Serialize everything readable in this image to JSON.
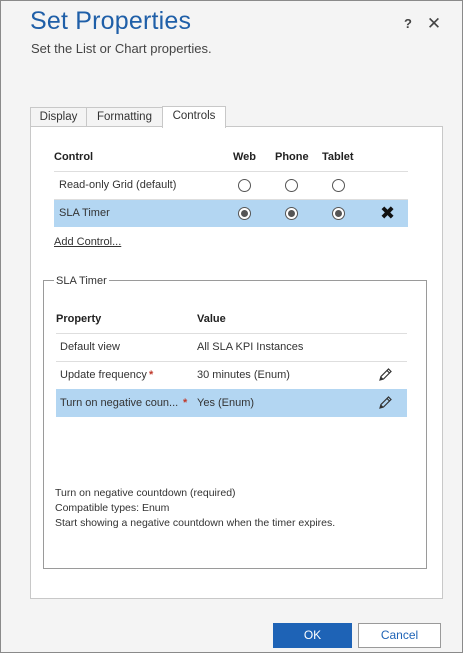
{
  "dialog": {
    "title": "Set Properties",
    "subtitle": "Set the List or Chart properties.",
    "help_label": "?",
    "close_label": "✕"
  },
  "tabs": [
    {
      "label": "Display",
      "active": false
    },
    {
      "label": "Formatting",
      "active": false
    },
    {
      "label": "Controls",
      "active": true
    }
  ],
  "controls_grid": {
    "headers": {
      "control": "Control",
      "web": "Web",
      "phone": "Phone",
      "tablet": "Tablet"
    },
    "rows": [
      {
        "name": "Read-only Grid (default)",
        "web": false,
        "phone": false,
        "tablet": false,
        "selected": false
      },
      {
        "name": "SLA Timer",
        "web": true,
        "phone": true,
        "tablet": true,
        "selected": true,
        "remove_icon": "✖"
      }
    ]
  },
  "add_control_label": "Add Control...",
  "sla_timer": {
    "legend": "SLA Timer",
    "headers": {
      "property": "Property",
      "value": "Value"
    },
    "rows": [
      {
        "property": "Default view",
        "value": "All SLA KPI Instances",
        "required": false,
        "editable": false,
        "selected": false
      },
      {
        "property": "Update frequency",
        "value": "30 minutes (Enum)",
        "required": true,
        "editable": true,
        "selected": false
      },
      {
        "property": "Turn on negative coun...",
        "value": "Yes (Enum)",
        "required": true,
        "editable": true,
        "selected": true
      }
    ],
    "required_mark": "*",
    "info": [
      "Turn on negative countdown (required)",
      "Compatible types: Enum",
      "Start showing a negative countdown when the timer expires."
    ]
  },
  "buttons": {
    "ok": "OK",
    "cancel": "Cancel"
  },
  "colors": {
    "accent": "#1e63b6",
    "selection": "#b3d6f2",
    "title": "#1f5fa8",
    "required": "#c0392b"
  }
}
